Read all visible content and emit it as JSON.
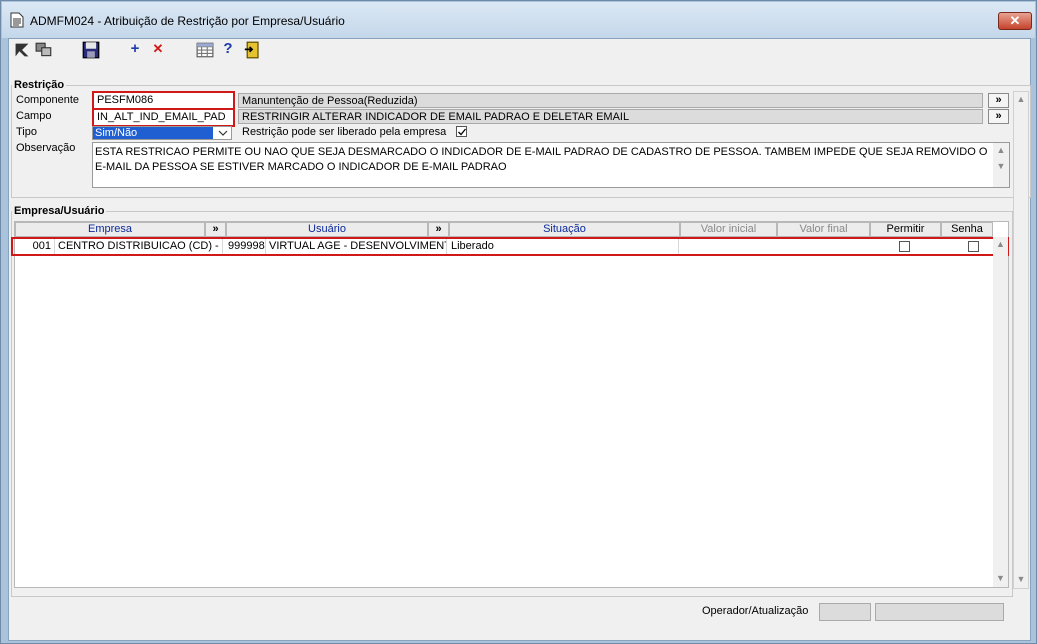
{
  "window": {
    "title": "ADMFM024 - Atribuição de Restrição por Empresa/Usuário",
    "close_label": "✕"
  },
  "toolbar": {
    "add_label": "+",
    "delete_label": "✕",
    "help_label": "?"
  },
  "restricao": {
    "group_label": "Restrição",
    "componente": {
      "label": "Componente",
      "value": "PESFM086",
      "desc": "Manuntenção de Pessoa(Reduzida)"
    },
    "campo": {
      "label": "Campo",
      "value": "IN_ALT_IND_EMAIL_PAD",
      "desc": "RESTRINGIR ALTERAR INDICADOR DE EMAIL PADRAO E DELETAR EMAIL"
    },
    "tipo": {
      "label": "Tipo",
      "value": "Sim/Não",
      "liberado_label": "Restrição pode ser liberado pela empresa",
      "liberado_checked": true
    },
    "observacao": {
      "label": "Observação",
      "value": "ESTA RESTRICAO PERMITE OU NAO QUE SEJA DESMARCADO O INDICADOR DE E-MAIL PADRAO DE CADASTRO DE PESSOA. TAMBEM IMPEDE QUE SEJA REMOVIDO O E-MAIL DA PESSOA SE ESTIVER MARCADO O INDICADOR DE E-MAIL PADRAO"
    },
    "expand_label": "»"
  },
  "empresa_usuario": {
    "group_label": "Empresa/Usuário",
    "columns": {
      "empresa": "Empresa",
      "usuario": "Usuário",
      "situacao": "Situação",
      "valor_inicial": "Valor inicial",
      "valor_final": "Valor final",
      "permitir": "Permitir",
      "senha": "Senha"
    },
    "expand_label": "»",
    "rows": [
      {
        "empresa_cod": "001",
        "empresa_nome": "CENTRO DISTRIBUICAO (CD) - FAT",
        "usuario_cod": "999998",
        "usuario_nome": "VIRTUAL AGE - DESENVOLVIMENTO",
        "situacao": "Liberado",
        "valor_inicial": "",
        "valor_final": "",
        "permitir": false,
        "senha": false
      }
    ]
  },
  "footer": {
    "operador_label": "Operador/Atualização",
    "operador_value": "",
    "atualizacao_value": ""
  },
  "colors": {
    "header_text": "#0b2a9a",
    "highlight_border": "#d01818",
    "selection": "#1f5fd1"
  }
}
